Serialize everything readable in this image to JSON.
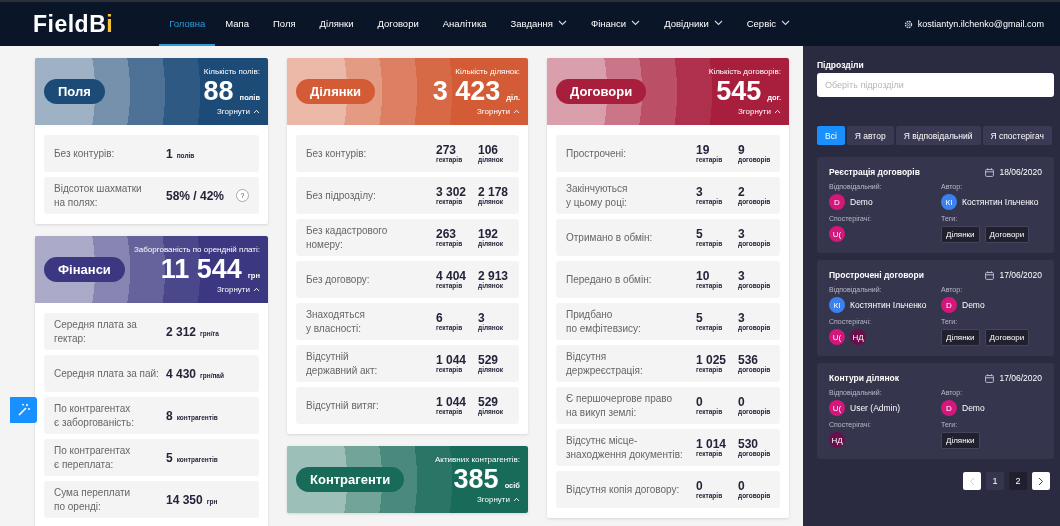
{
  "header": {
    "logo": {
      "main": "FieldB",
      "accent": "i"
    },
    "nav": [
      {
        "label": "Головна",
        "selected": true,
        "dropdown": false
      },
      {
        "label": "Мапа",
        "selected": false,
        "dropdown": false
      },
      {
        "label": "Поля",
        "selected": false,
        "dropdown": false
      },
      {
        "label": "Ділянки",
        "selected": false,
        "dropdown": false
      },
      {
        "label": "Договори",
        "selected": false,
        "dropdown": false
      },
      {
        "label": "Аналітика",
        "selected": false,
        "dropdown": false
      },
      {
        "label": "Завдання",
        "selected": false,
        "dropdown": true
      },
      {
        "label": "Фінанси",
        "selected": false,
        "dropdown": true
      },
      {
        "label": "Довідники",
        "selected": false,
        "dropdown": true
      },
      {
        "label": "Сервіс",
        "selected": false,
        "dropdown": true
      }
    ],
    "user": {
      "email": "kostiantyn.ilchenko@gmail.com"
    }
  },
  "columns": [
    {
      "cards": [
        {
          "title": "Поля",
          "color": "#1d4b78",
          "caption": "Кількість полів:",
          "value": "88",
          "unit": "полів",
          "collapse": "Згорнути",
          "rows": [
            {
              "kind": "single",
              "label": "Без контурів:",
              "values": [
                {
                  "value": "1",
                  "unit": "полів"
                }
              ]
            },
            {
              "kind": "single",
              "label": "Відсоток шахматки\nна полях:",
              "values": [
                {
                  "value": "58% / 42%"
                }
              ],
              "help": "?"
            }
          ]
        },
        {
          "title": "Фінанси",
          "color": "#3b3881",
          "caption": "Заборгованість по орендній платі:",
          "value": "11 544",
          "unit": "грн",
          "collapse": "Згорнути",
          "rows": [
            {
              "kind": "single",
              "label": "Середня плата за гектар:",
              "values": [
                {
                  "value": "2 312",
                  "unit": "грн/га"
                }
              ]
            },
            {
              "kind": "single",
              "label": "Середня плата за пай:",
              "values": [
                {
                  "value": "4 430",
                  "unit": "грн/пай"
                }
              ]
            },
            {
              "kind": "single",
              "label": "По контрагентах\nє заборгованість:",
              "values": [
                {
                  "value": "8",
                  "unit": "контрагентів"
                }
              ]
            },
            {
              "kind": "single",
              "label": "По контрагентах\nє переплата:",
              "values": [
                {
                  "value": "5",
                  "unit": "контрагентів"
                }
              ]
            },
            {
              "kind": "single",
              "label": "Сума переплати\nпо оренді:",
              "values": [
                {
                  "value": "14 350",
                  "unit": "грн"
                }
              ]
            }
          ]
        }
      ]
    },
    {
      "cards": [
        {
          "title": "Ділянки",
          "color": "#d35c37",
          "caption": "Кількість ділянок:",
          "value": "3 423",
          "unit": "діл.",
          "collapse": "Згорнути",
          "rows": [
            {
              "kind": "pair",
              "label": "Без контурів:",
              "values": [
                {
                  "value": "273",
                  "unit": "гектарів"
                },
                {
                  "value": "106",
                  "unit": "ділянок"
                }
              ]
            },
            {
              "kind": "pair",
              "label": "Без підрозділу:",
              "values": [
                {
                  "value": "3 302",
                  "unit": "гектарів"
                },
                {
                  "value": "2 178",
                  "unit": "ділянок"
                }
              ]
            },
            {
              "kind": "pair",
              "label": "Без кадастрового\nномеру:",
              "values": [
                {
                  "value": "263",
                  "unit": "гектарів"
                },
                {
                  "value": "192",
                  "unit": "ділянок"
                }
              ]
            },
            {
              "kind": "pair",
              "label": "Без договору:",
              "values": [
                {
                  "value": "4 404",
                  "unit": "гектарів"
                },
                {
                  "value": "2 913",
                  "unit": "ділянок"
                }
              ]
            },
            {
              "kind": "pair",
              "label": "Знаходяться\nу власності:",
              "values": [
                {
                  "value": "6",
                  "unit": "гектарів"
                },
                {
                  "value": "3",
                  "unit": "ділянок"
                }
              ]
            },
            {
              "kind": "pair",
              "label": "Відсутній\nдержавний акт:",
              "values": [
                {
                  "value": "1 044",
                  "unit": "гектарів"
                },
                {
                  "value": "529",
                  "unit": "ділянок"
                }
              ]
            },
            {
              "kind": "pair",
              "label": "Відсутній витяг:",
              "values": [
                {
                  "value": "1 044",
                  "unit": "гектарів"
                },
                {
                  "value": "529",
                  "unit": "ділянок"
                }
              ]
            }
          ]
        },
        {
          "title": "Контрагенти",
          "color": "#186a59",
          "caption": "Активних контрагентів:",
          "value": "385",
          "unit": "осіб",
          "collapse": "Згорнути"
        }
      ]
    },
    {
      "cards": [
        {
          "title": "Договори",
          "color": "#a81f3d",
          "caption": "Кількість договорів:",
          "value": "545",
          "unit": "дог.",
          "collapse": "Згорнути",
          "rows": [
            {
              "kind": "pair",
              "label": "Прострочені:",
              "values": [
                {
                  "value": "19",
                  "unit": "гектарів"
                },
                {
                  "value": "9",
                  "unit": "договорів"
                }
              ]
            },
            {
              "kind": "pair",
              "label": "Закінчуються\nу цьому році:",
              "values": [
                {
                  "value": "3",
                  "unit": "гектарів"
                },
                {
                  "value": "2",
                  "unit": "договорів"
                }
              ]
            },
            {
              "kind": "pair",
              "label": "Отримано в обмін:",
              "values": [
                {
                  "value": "5",
                  "unit": "гектарів"
                },
                {
                  "value": "3",
                  "unit": "договорів"
                }
              ]
            },
            {
              "kind": "pair",
              "label": "Передано в обмін:",
              "values": [
                {
                  "value": "10",
                  "unit": "гектарів"
                },
                {
                  "value": "3",
                  "unit": "договорів"
                }
              ]
            },
            {
              "kind": "pair",
              "label": "Придбано\nпо емфітевзису:",
              "values": [
                {
                  "value": "5",
                  "unit": "гектарів"
                },
                {
                  "value": "3",
                  "unit": "договорів"
                }
              ]
            },
            {
              "kind": "pair",
              "label": "Відсутня\nдержреєстрація:",
              "values": [
                {
                  "value": "1 025",
                  "unit": "гектарів"
                },
                {
                  "value": "536",
                  "unit": "договорів"
                }
              ]
            },
            {
              "kind": "pair",
              "label": "Є першочергове право\nна викуп землі:",
              "values": [
                {
                  "value": "0",
                  "unit": "гектарів"
                },
                {
                  "value": "0",
                  "unit": "договорів"
                }
              ]
            },
            {
              "kind": "pair",
              "label": "Відсутнє місце-\nзнаходження документів:",
              "values": [
                {
                  "value": "1 014",
                  "unit": "гектарів"
                },
                {
                  "value": "530",
                  "unit": "договорів"
                }
              ]
            },
            {
              "kind": "pair",
              "label": "Відсутня копія договору:",
              "values": [
                {
                  "value": "0",
                  "unit": "гектарів"
                },
                {
                  "value": "0",
                  "unit": "договорів"
                }
              ]
            }
          ]
        }
      ]
    }
  ],
  "sidebar": {
    "department": {
      "label": "Підрозділи",
      "placeholder": "Оберіть підрозділи"
    },
    "filters": [
      {
        "label": "Всі",
        "selected": true
      },
      {
        "label": "Я автор",
        "selected": false
      },
      {
        "label": "Я відповідальний",
        "selected": false
      },
      {
        "label": "Я спостерігач",
        "selected": false
      }
    ],
    "tasks": [
      {
        "title": "Реєстрація договорів",
        "date": "18/06/2020",
        "responsible_label": "Відповідальний:",
        "responsible": {
          "initials": "D",
          "name": "Demo",
          "color": "#d3177b"
        },
        "author_label": "Автор:",
        "author": {
          "initials": "КІ",
          "name": "Костянтин Ільченко",
          "color": "#3b82f0"
        },
        "watchers_label": "Спостерігачі:",
        "watchers": [
          {
            "initials": "U(",
            "color": "#d3177b"
          }
        ],
        "tags_label": "Теги:",
        "tags": [
          "Ділянки",
          "Договори"
        ]
      },
      {
        "title": "Прострочені договори",
        "date": "17/06/2020",
        "responsible_label": "Відповідальний:",
        "responsible": {
          "initials": "КІ",
          "name": "Костянтин Ільченко",
          "color": "#3b82f0"
        },
        "author_label": "Автор:",
        "author": {
          "initials": "D",
          "name": "Demo",
          "color": "#d3177b"
        },
        "watchers_label": "Спостерігачі:",
        "watchers": [
          {
            "initials": "U(",
            "color": "#d3177b"
          },
          {
            "initials": "НД",
            "color": "#6a0f4e"
          }
        ],
        "tags_label": "Теги:",
        "tags": [
          "Ділянки",
          "Договори"
        ]
      },
      {
        "title": "Контури ділянок",
        "date": "17/06/2020",
        "responsible_label": "Відповідальний:",
        "responsible": {
          "initials": "U(",
          "name": "User (Admin)",
          "color": "#d3177b"
        },
        "author_label": "Автор:",
        "author": {
          "initials": "D",
          "name": "Demo",
          "color": "#d3177b"
        },
        "watchers_label": "Спостерігачі:",
        "watchers": [
          {
            "initials": "НД",
            "color": "#6a0f4e"
          }
        ],
        "tags_label": "Теги:",
        "tags": [
          "Ділянки"
        ]
      }
    ],
    "pagination": {
      "prev": {
        "disabled": true
      },
      "pages": [
        {
          "label": "1",
          "selected": true
        },
        {
          "label": "2",
          "selected": false
        }
      ],
      "next": {
        "disabled": false
      }
    }
  }
}
